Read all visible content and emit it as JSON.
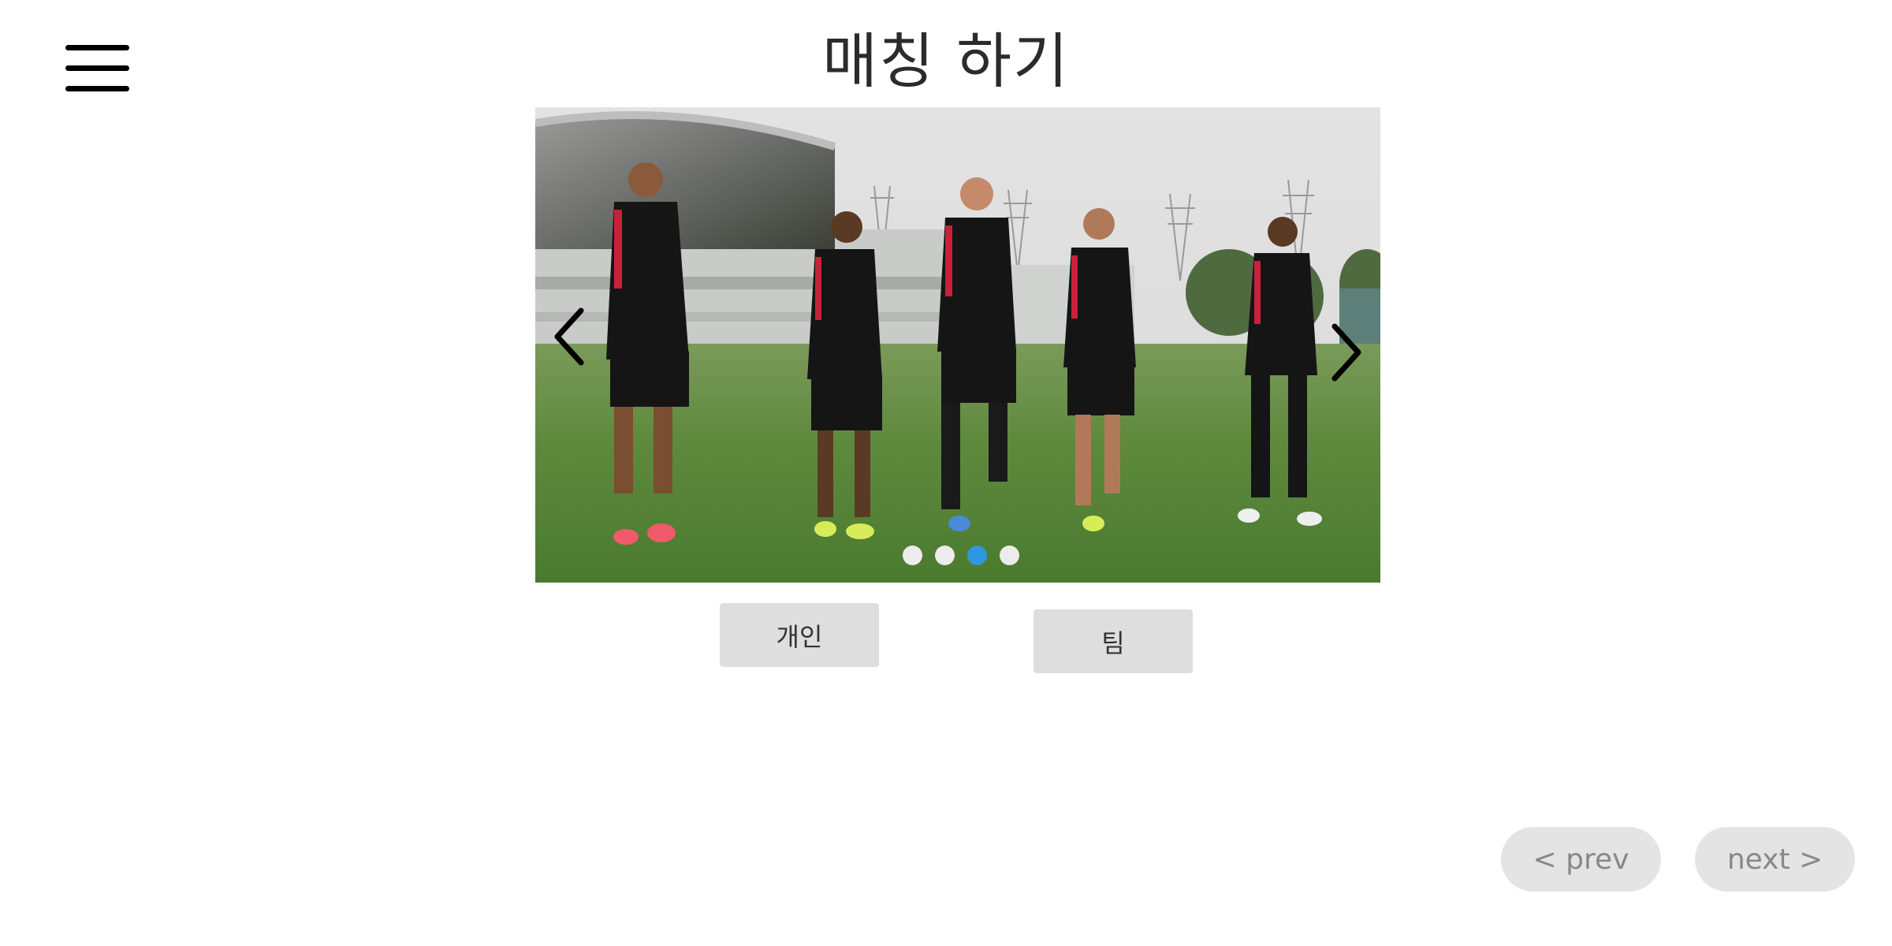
{
  "header": {
    "title": "매칭 하기",
    "menu_icon": "hamburger-menu-icon"
  },
  "carousel": {
    "image_alt": "Five soccer players in black training tops walking on a grass training pitch",
    "slide_count": 4,
    "active_index": 2,
    "active_color": "#2e97e0",
    "inactive_color": "#ececec",
    "prev_icon": "chevron-left-icon",
    "next_icon": "chevron-right-icon"
  },
  "choices": {
    "individual_label": "개인",
    "team_label": "팀"
  },
  "pager": {
    "prev_label": "< prev",
    "next_label": "next >"
  }
}
